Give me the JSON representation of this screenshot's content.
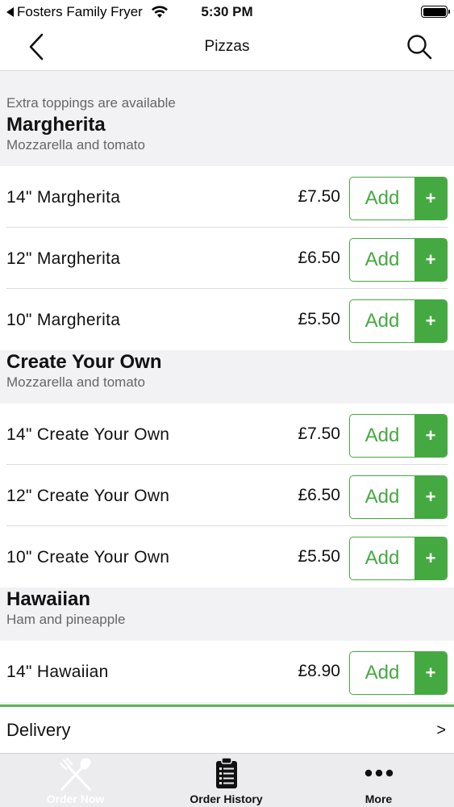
{
  "status_bar": {
    "back_app": "Fosters Family Fryer",
    "time": "5:30 PM"
  },
  "header": {
    "title": "Pizzas"
  },
  "notice": "Extra toppings are available",
  "add_label": "Add",
  "plus_label": "+",
  "groups": [
    {
      "title": "Margherita",
      "description": "Mozzarella and tomato",
      "items": [
        {
          "name": "14\" Margherita",
          "price": "£7.50"
        },
        {
          "name": "12\" Margherita",
          "price": "£6.50"
        },
        {
          "name": "10\" Margherita",
          "price": "£5.50"
        }
      ]
    },
    {
      "title": "Create Your Own",
      "description": "Mozzarella and tomato",
      "items": [
        {
          "name": "14\" Create Your Own",
          "price": "£7.50"
        },
        {
          "name": "12\" Create Your Own",
          "price": "£6.50"
        },
        {
          "name": "10\" Create Your Own",
          "price": "£5.50"
        }
      ]
    },
    {
      "title": "Hawaiian",
      "description": "Ham and pineapple",
      "items": [
        {
          "name": "14\" Hawaiian",
          "price": "£8.90"
        }
      ]
    }
  ],
  "delivery": {
    "label": "Delivery",
    "chevron": ">"
  },
  "tabs": [
    {
      "label": "Order Now",
      "icon": "fork-knife-icon",
      "active": true
    },
    {
      "label": "Order History",
      "icon": "clipboard-list-icon",
      "active": false
    },
    {
      "label": "More",
      "icon": "more-dots-icon",
      "active": false
    }
  ],
  "colors": {
    "accent": "#45a941",
    "delivery_border": "#5ab454",
    "background": "#f2f2f4"
  }
}
